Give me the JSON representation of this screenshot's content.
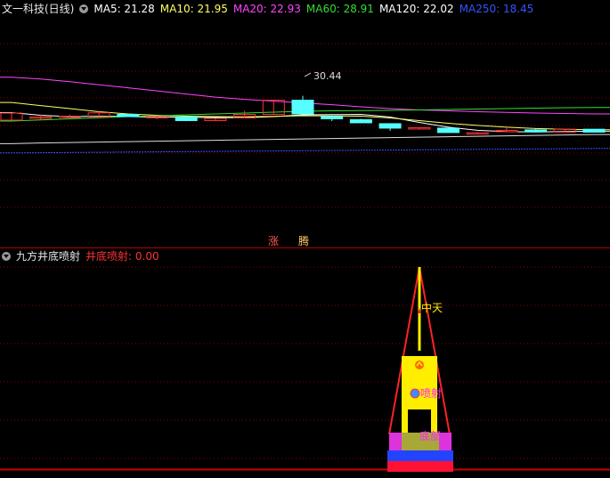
{
  "top_header": {
    "stock_name": "文一科技(日线)",
    "ma": [
      {
        "label": "MA5: 21.28",
        "color": "#ffffff"
      },
      {
        "label": "MA10: 21.95",
        "color": "#ffff66"
      },
      {
        "label": "MA20: 22.93",
        "color": "#ff44ff"
      },
      {
        "label": "MA60: 28.91",
        "color": "#33dd33"
      },
      {
        "label": "MA120: 22.02",
        "color": "#ffffff"
      },
      {
        "label": "MA250: 18.45",
        "color": "#3355ff"
      }
    ]
  },
  "high_label": "30.44",
  "tags": [
    "涨",
    "腾"
  ],
  "bottom_header": {
    "indicator_name": "九方井底喷射",
    "value_label": "井底喷射: 0.00"
  },
  "indicator_texts": {
    "zhongtian": "中天",
    "penshe": "喷射",
    "dibu": "底部"
  },
  "colors": {
    "up": "#ff3333",
    "down": "#55ffff",
    "grid": "#8b0000",
    "divider": "#b00000",
    "ma5": "#ffffff",
    "ma10": "#ffff66",
    "ma20": "#ff44ff",
    "ma60": "#33dd33",
    "ma120": "#dddddd",
    "ma250": "#3355ff"
  },
  "chart_data": {
    "type": "candlestick",
    "candles": [
      {
        "o": 21.0,
        "c": 22.6,
        "h": 22.7,
        "l": 20.9
      },
      {
        "o": 21.6,
        "c": 21.7,
        "h": 22.3,
        "l": 21.1
      },
      {
        "o": 21.75,
        "c": 21.9,
        "h": 22.2,
        "l": 21.6
      },
      {
        "o": 21.75,
        "c": 22.65,
        "h": 23.1,
        "l": 21.6
      },
      {
        "o": 22.3,
        "c": 21.8,
        "h": 22.5,
        "l": 21.7
      },
      {
        "o": 21.8,
        "c": 21.82,
        "h": 21.9,
        "l": 21.2
      },
      {
        "o": 21.7,
        "c": 20.9,
        "h": 21.9,
        "l": 20.8
      },
      {
        "o": 20.9,
        "c": 21.4,
        "h": 21.5,
        "l": 20.8
      },
      {
        "o": 21.5,
        "c": 22.3,
        "h": 23.1,
        "l": 21.4
      },
      {
        "o": 22.3,
        "c": 25.5,
        "h": 25.6,
        "l": 22.2
      },
      {
        "o": 25.5,
        "c": 22.4,
        "h": 26.5,
        "l": 22.3
      },
      {
        "o": 21.8,
        "c": 21.3,
        "h": 22.1,
        "l": 20.8
      },
      {
        "o": 21.1,
        "c": 20.4,
        "h": 21.3,
        "l": 20.3
      },
      {
        "o": 20.2,
        "c": 19.2,
        "h": 20.3,
        "l": 18.6
      },
      {
        "o": 19.1,
        "c": 19.3,
        "h": 19.35,
        "l": 19.05
      },
      {
        "o": 19.2,
        "c": 18.2,
        "h": 19.2,
        "l": 18.2
      },
      {
        "o": 18.05,
        "c": 18.15,
        "h": 18.3,
        "l": 17.95
      },
      {
        "o": 18.6,
        "c": 18.7,
        "h": 19.4,
        "l": 18.4
      },
      {
        "o": 18.8,
        "c": 18.35,
        "h": 19.1,
        "l": 18.3
      },
      {
        "o": 18.3,
        "c": 18.95,
        "h": 19.0,
        "l": 18.2
      },
      {
        "o": 18.95,
        "c": 18.3,
        "h": 19.0,
        "l": 18.2
      }
    ],
    "ma_lines": {
      "MA5": [
        22.7,
        22.1,
        21.8,
        21.9,
        21.8,
        21.7,
        21.65,
        21.6,
        21.55,
        21.8,
        22.2,
        22.25,
        22.3,
        21.7,
        20.5,
        19.4,
        18.7,
        18.4,
        18.35,
        18.45,
        18.5
      ],
      "MA10": [
        25.0,
        24.3,
        23.6,
        22.9,
        22.4,
        22.1,
        21.9,
        21.8,
        21.75,
        21.85,
        22.0,
        21.95,
        21.9,
        21.5,
        20.9,
        20.3,
        19.8,
        19.4,
        19.1,
        18.95,
        18.85
      ],
      "MA20": [
        30.7,
        30.3,
        29.7,
        29.0,
        28.3,
        27.6,
        26.9,
        26.2,
        25.7,
        25.3,
        24.9,
        24.5,
        24.0,
        23.6,
        23.3,
        23.1,
        22.9,
        22.75,
        22.6,
        22.5,
        22.4
      ],
      "MA60": [
        20.8,
        21.05,
        21.3,
        21.55,
        21.8,
        22.0,
        22.2,
        22.4,
        22.6,
        22.8,
        23.0,
        23.1,
        23.15,
        23.2,
        23.3,
        23.4,
        23.5,
        23.6,
        23.7,
        23.8,
        23.85
      ],
      "MA120": [
        15.7,
        15.85,
        15.95,
        16.05,
        16.15,
        16.25,
        16.35,
        16.45,
        16.55,
        16.65,
        16.75,
        16.85,
        16.95,
        17.05,
        17.15,
        17.25,
        17.35,
        17.45,
        17.55,
        17.65,
        17.75
      ],
      "MA250": [
        13.6,
        13.65,
        13.7,
        13.75,
        13.8,
        13.85,
        13.9,
        13.95,
        14.0,
        14.05,
        14.1,
        14.15,
        14.2,
        14.25,
        14.3,
        14.35,
        14.4,
        14.45,
        14.5,
        14.55,
        14.6
      ]
    },
    "annotation": {
      "text": "30.44",
      "index": 10
    }
  }
}
